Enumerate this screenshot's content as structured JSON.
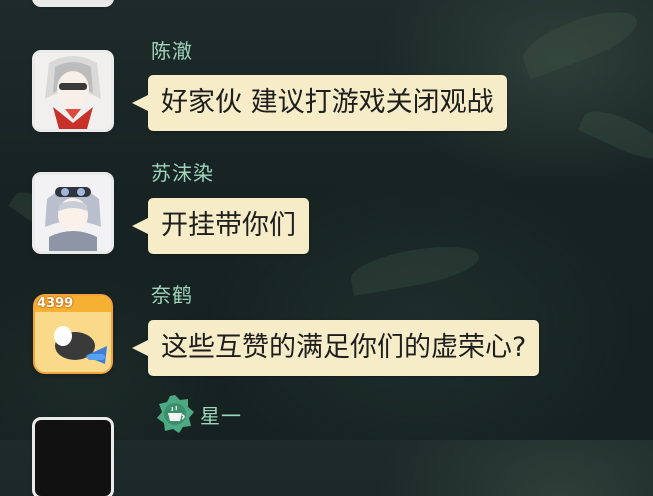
{
  "messages": [
    {
      "sender": "",
      "text": "",
      "avatar_icon": "partial-avatar"
    },
    {
      "sender": "陈澈",
      "text": "好家伙 建议打游戏关闭观战",
      "avatar_icon": "anime-character-red-scarf-avatar"
    },
    {
      "sender": "苏沫染",
      "text": "开挂带你们",
      "avatar_icon": "anime-boy-goggles-avatar"
    },
    {
      "sender": "奈鹤",
      "text": "这些互赞的满足你们的虚荣心?",
      "avatar_icon": "4399-game-avatar",
      "badge": "4399"
    },
    {
      "sender": "星一",
      "text": "",
      "avatar_icon": "dark-avatar",
      "decoration_icon": "tea-cup-badge-icon"
    }
  ],
  "colors": {
    "bubble": "#f6ecc7",
    "sender_name": "#9ed6bd",
    "background": "#1b2726"
  }
}
